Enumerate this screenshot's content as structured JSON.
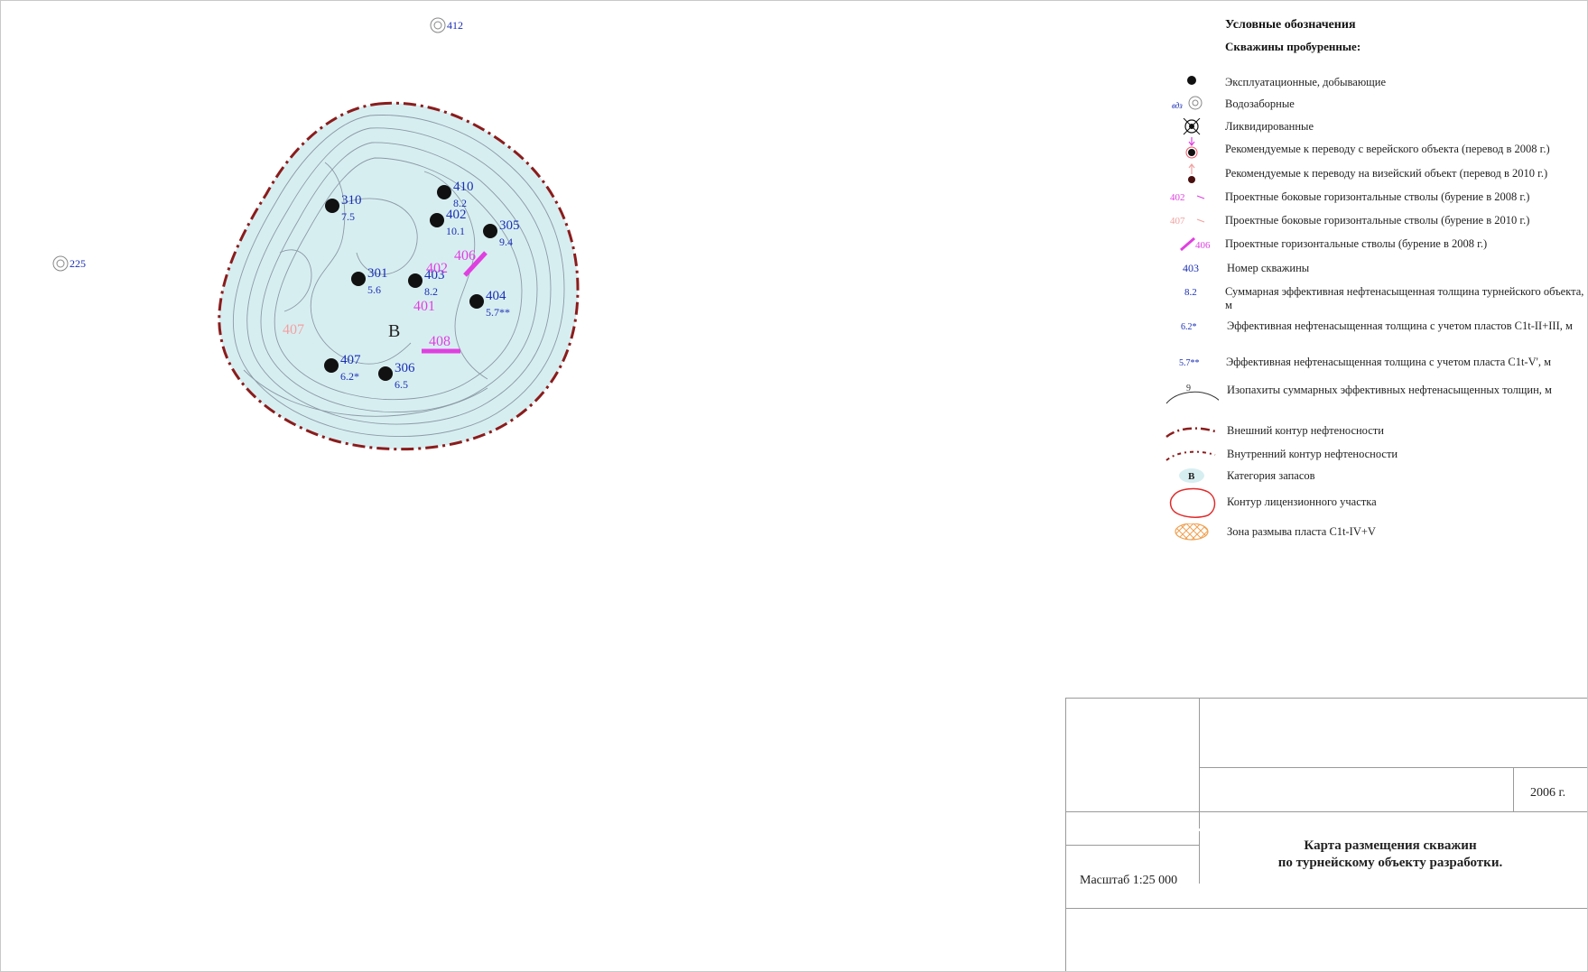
{
  "map": {
    "outside_wells": [
      {
        "id": "412"
      },
      {
        "id": "225"
      }
    ],
    "wells": [
      {
        "id": "310",
        "value": "7.5"
      },
      {
        "id": "410",
        "value": "8.2"
      },
      {
        "id": "402",
        "value": "10.1"
      },
      {
        "id": "305",
        "value": "9.4"
      },
      {
        "id": "301",
        "value": "5.6"
      },
      {
        "id": "403",
        "value": "8.2"
      },
      {
        "id": "404",
        "value": "5.7**"
      },
      {
        "id": "407",
        "value": "6.2*"
      },
      {
        "id": "306",
        "value": "6.5"
      }
    ],
    "projected_labels": [
      {
        "id": "402",
        "color": "#e040e0"
      },
      {
        "id": "406",
        "color": "#e040e0"
      },
      {
        "id": "401",
        "color": "#e040e0"
      },
      {
        "id": "408",
        "color": "#e040e0"
      },
      {
        "id": "407",
        "color": "#f2a0a0"
      }
    ],
    "reserve_category": "В",
    "colors": {
      "field_fill": "#d7eef1",
      "contour_line": "#8a9aa5",
      "oil_boundary": "#8b1c1c",
      "well_label": "#1a2fb5",
      "projected_2008": "#e040e0",
      "projected_2010": "#f2a0a0",
      "license_contour": "#e02a2a",
      "erosion_zone": "#f0a050"
    }
  },
  "legend": {
    "title": "Условные обозначения",
    "subtitle": "Скважины пробуренные:",
    "items": [
      {
        "symbol": "dot",
        "text": "Эксплуатационные, добывающие"
      },
      {
        "symbol": "water-well-icon",
        "prefix": "вдз",
        "text": "Водозаборные"
      },
      {
        "symbol": "abandoned-well-icon",
        "text": "Ликвидированные"
      },
      {
        "symbol": "transfer-2008-icon",
        "text": "Рекомендуемые к переводу с верейского объекта (перевод в 2008 г.)"
      },
      {
        "symbol": "transfer-2010-icon",
        "text": "Рекомендуемые к переводу на визейский объект (перевод в 2010 г.)"
      },
      {
        "symbol": "sidetrack-2008-icon",
        "code": "402",
        "text": "Проектные боковые горизонтальные стволы (бурение  в 2008 г.)"
      },
      {
        "symbol": "sidetrack-2010-icon",
        "code": "407",
        "text": "Проектные боковые горизонтальные стволы (бурение  в 2010 г.)"
      },
      {
        "symbol": "horizontal-2008-icon",
        "code": "406",
        "text": "Проектные горизонтальные стволы (бурение  в 2008 г.)"
      },
      {
        "symbol": "well-number",
        "code": "403",
        "text": "Номер скважины"
      },
      {
        "symbol": "thickness",
        "code": "8.2",
        "text": "Суммарная эффективная нефтенасыщенная толщина турнейского объекта, м"
      },
      {
        "symbol": "thickness-star",
        "code": "6.2*",
        "text": "Эффективная нефтенасыщенная толщина с учетом пластов C1t-II+III, м"
      },
      {
        "symbol": "thickness-2star",
        "code": "5.7**",
        "text": " Эффективная нефтенасыщенная толщина с учетом пласта C1t-V', м"
      },
      {
        "symbol": "isopach-icon",
        "code": "9",
        "text": "Изопахиты суммарных эффективных нефтенасыщенных толщин, м"
      },
      {
        "symbol": "outer-contour-icon",
        "text": "Внешний контур нефтеносности"
      },
      {
        "symbol": "inner-contour-icon",
        "text": "Внутренний контур нефтеносности"
      },
      {
        "symbol": "category-icon",
        "code": "В",
        "text": "Категория  запасов"
      },
      {
        "symbol": "license-contour-icon",
        "text": "Контур лицензионного участка"
      },
      {
        "symbol": "erosion-zone-icon",
        "text": "Зона размыва пласта C1t-IV+V"
      }
    ]
  },
  "stamp": {
    "year": "2006 г.",
    "scale": "Масштаб 1:25 000",
    "title_line1": "Карта размещения скважин",
    "title_line2": "по турнейскому объекту разработки."
  }
}
